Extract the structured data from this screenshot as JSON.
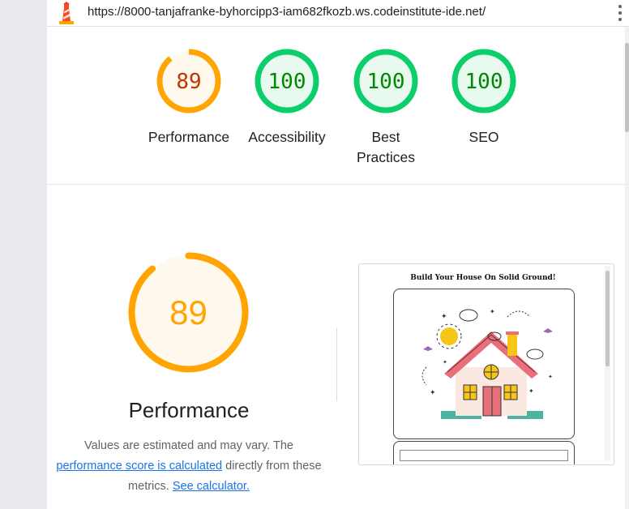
{
  "url": "https://8000-tanjafranke-byhorcipp3-iam682fkozb.ws.codeinstitute-ide.net/",
  "gauges": [
    {
      "score": "89",
      "label": "Performance",
      "status": "average",
      "fraction": 0.89
    },
    {
      "score": "100",
      "label": "Accessibility",
      "status": "pass",
      "fraction": 1.0
    },
    {
      "score": "100",
      "label": "Best Practices",
      "status": "pass",
      "fraction": 1.0
    },
    {
      "score": "100",
      "label": "SEO",
      "status": "pass",
      "fraction": 1.0
    }
  ],
  "colors": {
    "average_stroke": "#ffa400",
    "average_text": "#c33300",
    "average_fill": "#fff8ec",
    "pass_stroke": "#0cce6b",
    "pass_text": "#008800",
    "pass_fill": "#e8f9ef",
    "link": "#1a73e8"
  },
  "performance": {
    "score": "89",
    "fraction": 0.89,
    "title": "Performance",
    "desc_1": "Values are estimated and may vary. The",
    "link_1": "performance score is calculated",
    "desc_2": "directly from these",
    "desc_3": "metrics.",
    "link_2": "See calculator."
  },
  "screenshot": {
    "title": "Build Your House On Solid Ground!"
  },
  "icons": {
    "logo": "lighthouse-logo-icon",
    "menu": "more-vert-icon"
  }
}
